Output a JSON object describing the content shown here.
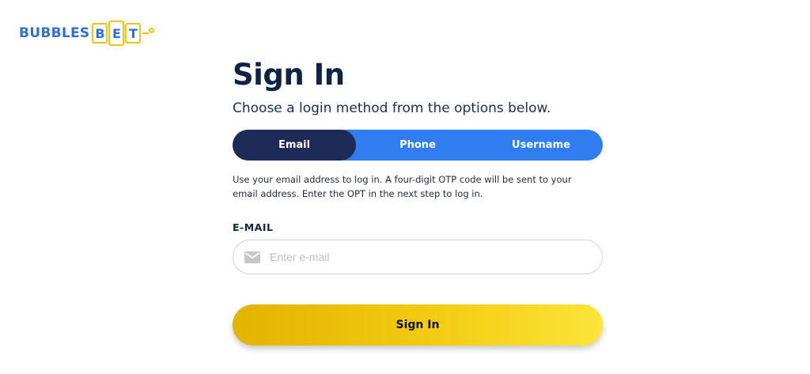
{
  "logo": {
    "word": "BUBBLES",
    "tiles": [
      "B",
      "E",
      "T"
    ]
  },
  "page": {
    "title": "Sign In",
    "subtitle": "Choose a login method from the options below."
  },
  "tabs": [
    {
      "label": "Email",
      "active": true
    },
    {
      "label": "Phone",
      "active": false
    },
    {
      "label": "Username",
      "active": false
    }
  ],
  "helper_text": "Use your email address to log in. A four-digit OTP code will be sent to your email address. Enter the OPT in the next step to log in.",
  "email_field": {
    "label": "E-MAIL",
    "placeholder": "Enter e-mail",
    "value": "",
    "icon": "mail-icon"
  },
  "submit": {
    "label": "Sign In"
  },
  "colors": {
    "brand_blue": "#2f7df0",
    "tab_active": "#1e2a58",
    "heading": "#0f2347",
    "button_yellow": "#f2cc12"
  }
}
